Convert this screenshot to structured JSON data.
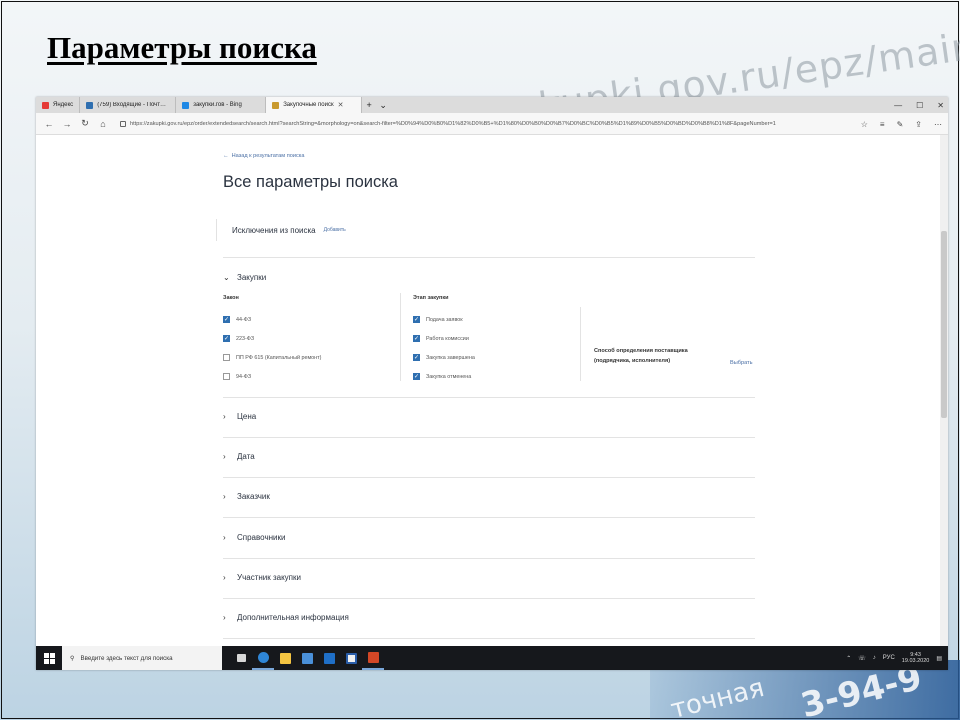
{
  "slide": {
    "title": "Параметры поиска",
    "bg_url": "zakupki.gov.ru/epz/main/public/home.html",
    "bg_bottom_text_1": "точная",
    "bg_bottom_text_2": "3-94-9"
  },
  "browser": {
    "tabs": [
      {
        "label": "Яндекс",
        "icon": "yandex-icon",
        "color": "#e53935",
        "active": false
      },
      {
        "label": "(759) Входящие - Почта М…",
        "icon": "mail-icon",
        "color": "#2f6fb0",
        "active": false
      },
      {
        "label": "закупки.гов - Bing",
        "icon": "bing-icon",
        "color": "#1e88e5",
        "active": false
      },
      {
        "label": "Закупочные поиск",
        "icon": "site-icon",
        "color": "#c99a2e",
        "active": true
      }
    ],
    "new_tab": "+",
    "url": "https://zakupki.gov.ru/epz/order/extendedsearch/search.html?searchString=&morphology=on&search-filter=%D0%94%D0%B0%D1%82%D0%B5+%D1%80%D0%B0%D0%B7%D0%BC%D0%B5%D1%89%D0%B5%D0%BD%D0%B8%D1%8F&pageNumber=1"
  },
  "page": {
    "back_link": "Назад к результатам поиска",
    "heading": "Все параметры поиска",
    "exclusions": {
      "label": "Исключения из поиска",
      "add": "Добавить"
    },
    "purchases": {
      "label": "Закупки",
      "law_header": "Закон",
      "laws": [
        {
          "label": "44-ФЗ",
          "checked": true
        },
        {
          "label": "223-ФЗ",
          "checked": true
        },
        {
          "label": "ПП РФ 615 (Капитальный ремонт)",
          "checked": false
        },
        {
          "label": "94-ФЗ",
          "checked": false
        }
      ],
      "stage_header": "Этап закупки",
      "stages": [
        {
          "label": "Подача заявок",
          "checked": true
        },
        {
          "label": "Работа комиссии",
          "checked": true
        },
        {
          "label": "Закупка завершена",
          "checked": true
        },
        {
          "label": "Закупка отменена",
          "checked": true
        }
      ],
      "supplier_label": "Способ определения поставщика (подрядчика, исполнителя)",
      "supplier_action": "Выбрать"
    },
    "sections": [
      "Цена",
      "Дата",
      "Заказчик",
      "Справочники",
      "Участник закупки",
      "Дополнительная информация"
    ]
  },
  "taskbar": {
    "search_placeholder": "Введите здесь текст для поиска",
    "lang": "РУС",
    "time": "9:43",
    "date": "19.03.2020"
  }
}
